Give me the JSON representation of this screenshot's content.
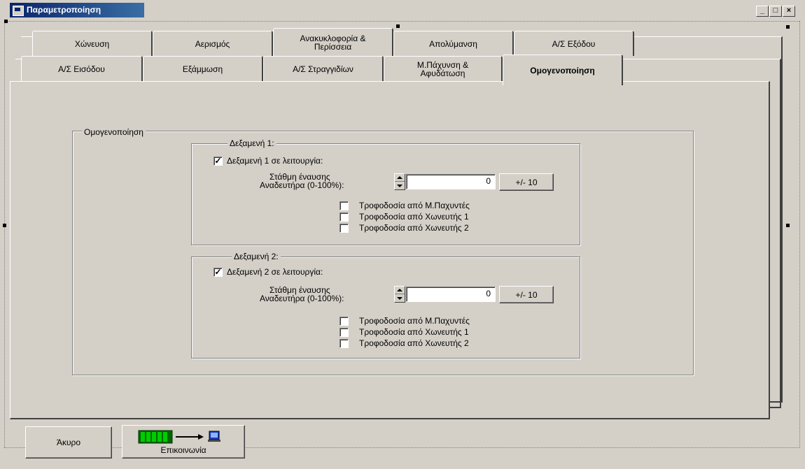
{
  "window": {
    "title": "Παραμετροποίηση",
    "min": "_",
    "max": "□",
    "close": "×"
  },
  "tabs_row1": [
    "Χώνευση",
    "Αερισμός",
    "Ανακυκλοφορία & Περίσσεια",
    "Απολύμανση",
    "Α/Σ Εξόδου"
  ],
  "tabs_row2": [
    "Α/Σ Εισόδου",
    "Εξάμμωση",
    "Α/Σ Στραγγιδίων",
    "Μ.Πάχυνση & Αφυδάτωση",
    "Ομογενοποίηση"
  ],
  "active_tab": "Ομογενοποίηση",
  "group": {
    "title": "Ομογενοποίηση",
    "tank1": {
      "title": "Δεξαμενή 1:",
      "enabled_label": "Δεξαμενή 1 σε λειτουργία:",
      "enabled": "✓",
      "level_label_line1": "Στάθμη έναυσης",
      "level_label_line2": "Αναδευτήρα (0-100%):",
      "level_value": "0",
      "step_button": "+/- 10",
      "feeds": [
        "Τροφοδοσία από Μ.Παχυντές",
        "Τροφοδοσία από Χωνευτής 1",
        "Τροφοδοσία από Χωνευτής 2"
      ]
    },
    "tank2": {
      "title": "Δεξαμενή 2:",
      "enabled_label": "Δεξαμενή 2 σε λειτουργία:",
      "enabled": "✓",
      "level_label_line1": "Στάθμη έναυσης",
      "level_label_line2": "Αναδευτήρα (0-100%):",
      "level_value": "0",
      "step_button": "+/- 10",
      "feeds": [
        "Τροφοδοσία από Μ.Παχυντές",
        "Τροφοδοσία από Χωνευτής 1",
        "Τροφοδοσία από Χωνευτής 2"
      ]
    }
  },
  "footer": {
    "cancel": "Άκυρο",
    "comm": "Επικοινωνία"
  },
  "colors": {
    "face": "#d4d0c8",
    "titlebar": "#0a246a",
    "comm_icon": "#00a000"
  }
}
